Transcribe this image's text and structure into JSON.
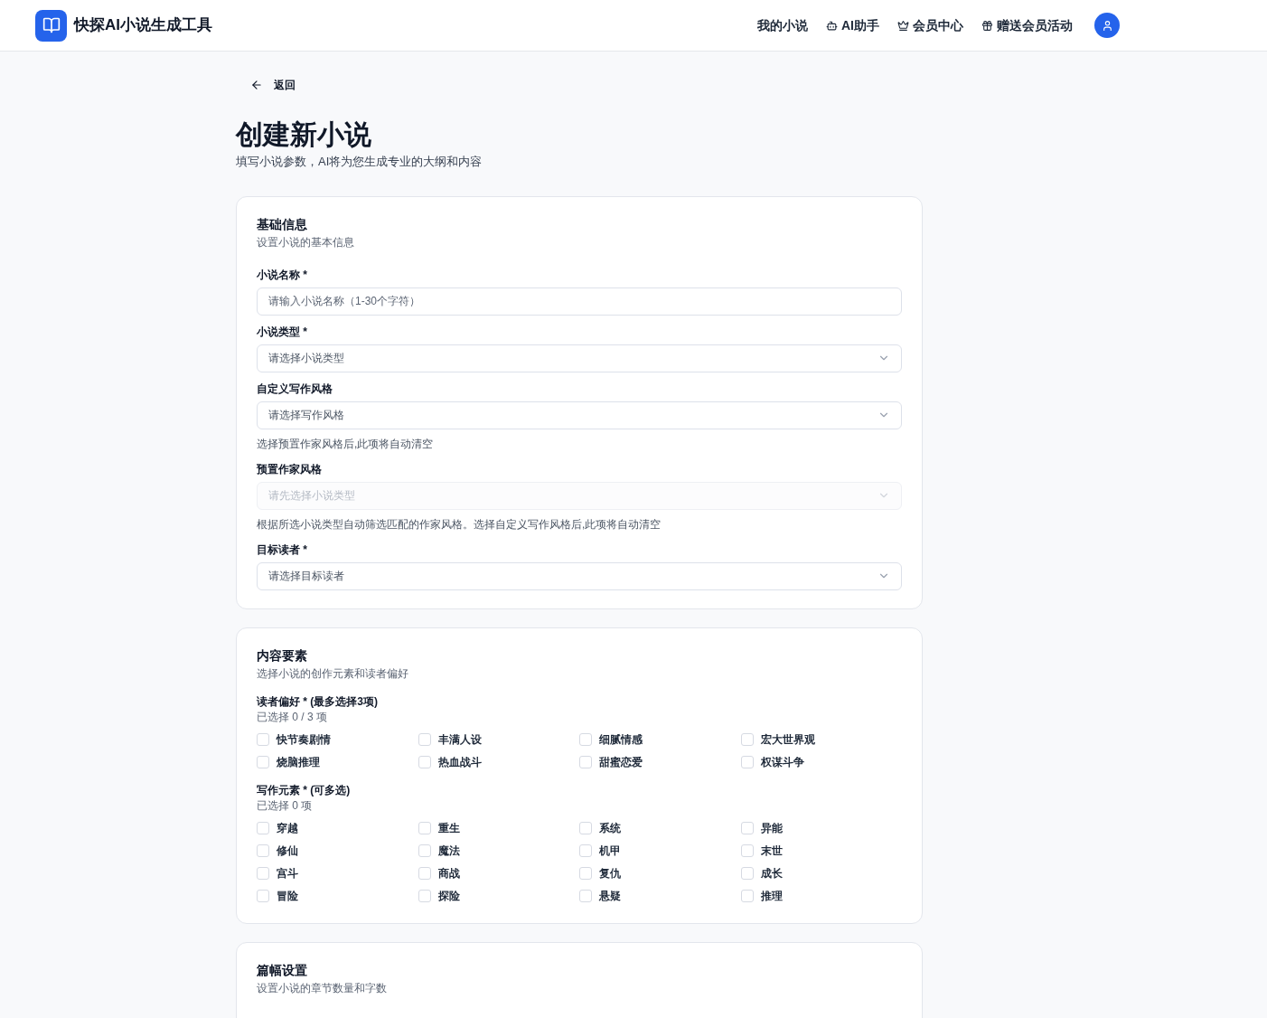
{
  "header": {
    "brand": "快探AI小说生成工具",
    "nav": [
      {
        "label": "我的小说",
        "kind": "plain"
      },
      {
        "label": "AI助手",
        "kind": "bot"
      },
      {
        "label": "会员中心",
        "kind": "crown"
      },
      {
        "label": "赠送会员活动",
        "kind": "gift"
      }
    ]
  },
  "back": "返回",
  "title": "创建新小说",
  "subtitle": "填写小说参数，AI将为您生成专业的大纲和内容",
  "basic": {
    "title": "基础信息",
    "subtitle": "设置小说的基本信息",
    "fields": [
      {
        "label": "小说名称 *",
        "kind": "text",
        "placeholder": "请输入小说名称（1-30个字符）"
      },
      {
        "label": "小说类型 *",
        "kind": "select",
        "placeholder": "请选择小说类型"
      },
      {
        "label": "自定义写作风格",
        "kind": "select",
        "placeholder": "请选择写作风格",
        "hint": "选择预置作家风格后,此项将自动清空"
      },
      {
        "label": "预置作家风格",
        "kind": "select",
        "placeholder": "请先选择小说类型",
        "disabled": true,
        "hint": "根据所选小说类型自动筛选匹配的作家风格。选择自定义写作风格后,此项将自动清空"
      },
      {
        "label": "目标读者 *",
        "kind": "select",
        "placeholder": "请选择目标读者"
      }
    ]
  },
  "content": {
    "title": "内容要素",
    "subtitle": "选择小说的创作元素和读者偏好",
    "groups": [
      {
        "label": "读者偏好 * (最多选择3项)",
        "counter": "已选择 0 / 3 项",
        "options": [
          {
            "label": "快节奏剧情",
            "checked": false
          },
          {
            "label": "丰满人设",
            "checked": false
          },
          {
            "label": "细腻情感",
            "checked": false
          },
          {
            "label": "宏大世界观",
            "checked": false
          },
          {
            "label": "烧脑推理",
            "checked": false
          },
          {
            "label": "热血战斗",
            "checked": false
          },
          {
            "label": "甜蜜恋爱",
            "checked": false
          },
          {
            "label": "权谋斗争",
            "checked": false
          }
        ]
      },
      {
        "label": "写作元素 * (可多选)",
        "counter": "已选择 0 项",
        "options": [
          {
            "label": "穿越",
            "checked": false
          },
          {
            "label": "重生",
            "checked": false
          },
          {
            "label": "系统",
            "checked": false
          },
          {
            "label": "异能",
            "checked": false
          },
          {
            "label": "修仙",
            "checked": false
          },
          {
            "label": "魔法",
            "checked": false
          },
          {
            "label": "机甲",
            "checked": false
          },
          {
            "label": "末世",
            "checked": false
          },
          {
            "label": "宫斗",
            "checked": false
          },
          {
            "label": "商战",
            "checked": false
          },
          {
            "label": "复仇",
            "checked": false
          },
          {
            "label": "成长",
            "checked": false
          },
          {
            "label": "冒险",
            "checked": false
          },
          {
            "label": "探险",
            "checked": false
          },
          {
            "label": "悬疑",
            "checked": false
          },
          {
            "label": "推理",
            "checked": false
          }
        ]
      }
    ]
  },
  "length": {
    "title": "篇幅设置",
    "subtitle": "设置小说的章节数量和字数"
  }
}
